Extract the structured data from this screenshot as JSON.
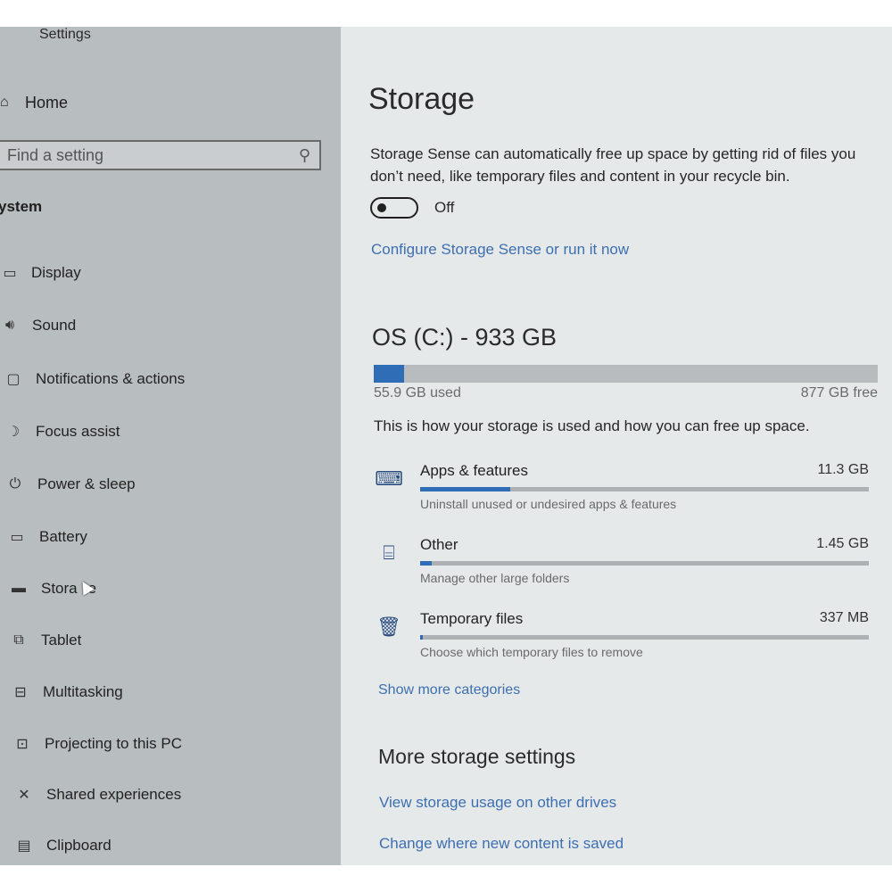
{
  "sidebar": {
    "app_title": "Settings",
    "home_label": "Home",
    "search_placeholder": "Find a setting",
    "section_label": "ystem",
    "items": [
      {
        "label": "Display",
        "icon": "display-icon"
      },
      {
        "label": "Sound",
        "icon": "speaker-icon"
      },
      {
        "label": "Notifications & actions",
        "icon": "notification-icon"
      },
      {
        "label": "Focus assist",
        "icon": "moon-icon"
      },
      {
        "label": "Power & sleep",
        "icon": "power-icon"
      },
      {
        "label": "Battery",
        "icon": "battery-icon"
      },
      {
        "label": "Stora",
        "icon": "storage-icon"
      },
      {
        "label": "Tablet",
        "icon": "tablet-icon"
      },
      {
        "label": "Multitasking",
        "icon": "multitasking-icon"
      },
      {
        "label": "Projecting to this PC",
        "icon": "projector-icon"
      },
      {
        "label": "Shared experiences",
        "icon": "shared-experiences-icon"
      },
      {
        "label": "Clipboard",
        "icon": "clipboard-icon"
      }
    ],
    "selected_item": "Storage"
  },
  "main": {
    "title": "Storage",
    "storage_sense": {
      "description": "Storage Sense can automatically free up space by getting rid of files you don’t need, like temporary files and content in your recycle bin.",
      "toggle_state": "Off",
      "configure_link": "Configure Storage Sense or run it now"
    },
    "drive": {
      "title": "OS (C:) - 933 GB",
      "used_label": "55.9 GB used",
      "free_label": "877 GB free",
      "used_fraction": 0.06
    },
    "usage_description": "This is how your storage is used and how you can free up space.",
    "categories": [
      {
        "name": "Apps & features",
        "size": "11.3 GB",
        "subtitle": "Uninstall unused or undesired apps & features",
        "fraction": 0.2,
        "icon": "keyboard-icon"
      },
      {
        "name": "Other",
        "size": "1.45 GB",
        "subtitle": "Manage other large folders",
        "fraction": 0.026,
        "icon": "folder-icon"
      },
      {
        "name": "Temporary files",
        "size": "337 MB",
        "subtitle": "Choose which temporary files to remove",
        "fraction": 0.006,
        "icon": "trash-icon"
      }
    ],
    "show_more_label": "Show more categories",
    "more_settings": {
      "title": "More storage settings",
      "link1": "View storage usage on other drives",
      "link2": "Change where new content is saved"
    }
  },
  "colors": {
    "accent": "#2f6db6",
    "link": "#3d6fb0"
  }
}
